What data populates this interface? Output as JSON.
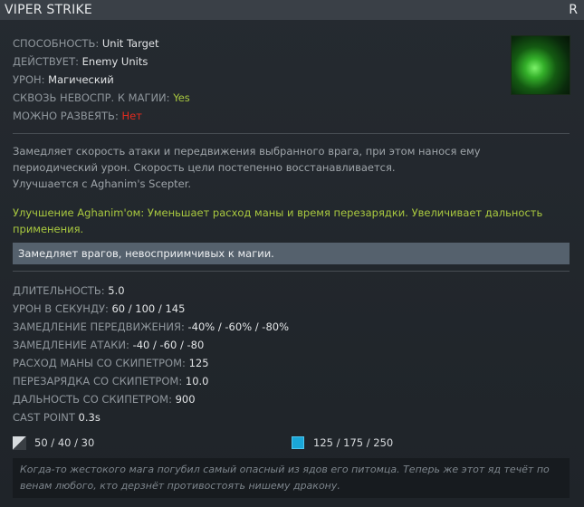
{
  "header": {
    "title": "VIPER STRIKE",
    "hotkey": "R"
  },
  "ability_icon": "viper-strike-ability-icon",
  "properties": [
    {
      "label": "СПОСОБНОСТЬ: ",
      "value": "Unit Target",
      "color": "#e2e4e6"
    },
    {
      "label": "ДЕЙСТВУЕТ: ",
      "value": "Enemy Units",
      "color": "#e2e4e6"
    },
    {
      "label": "УРОН: ",
      "value": "Магический",
      "color": "#e2e4e6"
    },
    {
      "label": "СКВОЗЬ НЕВОСПР. К МАГИИ: ",
      "value": "Yes",
      "color": "#a9c93f"
    },
    {
      "label": "МОЖНО РАЗВЕЯТЬ: ",
      "value": "Нет",
      "color": "#e22b1f"
    }
  ],
  "description": {
    "text": "Замедляет скорость атаки и передвижения выбранного врага, при этом нанося ему периодический урон. Скорость цели постепенно восстанавливается.",
    "scepter_line": "Улучшается с Aghanim's Scepter."
  },
  "upgrade": "Улучшение Aghanim'ом: Уменьшает расход маны и время перезарядки. Увеличивает дальность применения.",
  "note": "Замедляет врагов, невосприимчивых к магии.",
  "stats": [
    {
      "label": "ДЛИТЕЛЬНОСТЬ: ",
      "value": "5.0"
    },
    {
      "label": "УРОН В СЕКУНДУ: ",
      "value": "60 / 100 / 145"
    },
    {
      "label": "ЗАМЕДЛЕНИЕ ПЕРЕДВИЖЕНИЯ: ",
      "value": "-40% / -60% / -80%"
    },
    {
      "label": "ЗАМЕДЛЕНИЕ АТАКИ: ",
      "value": "-40 / -60 / -80"
    },
    {
      "label": "РАСХОД МАНЫ СО СКИПЕТРОМ: ",
      "value": "125"
    },
    {
      "label": "ПЕРЕЗАРЯДКА СО СКИПЕТРОМ: ",
      "value": "10.0"
    },
    {
      "label": "ДАЛЬНОСТЬ СО СКИПЕТРОМ: ",
      "value": "900"
    },
    {
      "label": "CAST POINT ",
      "value": "0.3s"
    }
  ],
  "costs": {
    "cooldown": "50 / 40 / 30",
    "cooldown_icon": "cooldown-icon",
    "mana": "125 / 175 / 250",
    "mana_icon": "mana-icon",
    "mana_color": "#1aa7d8"
  },
  "lore": "Когда-то жестокого мага погубил самый опасный из ядов его питомца. Теперь же этот яд течёт по венам любого, кто дерзнёт противостоять нишему дракону."
}
